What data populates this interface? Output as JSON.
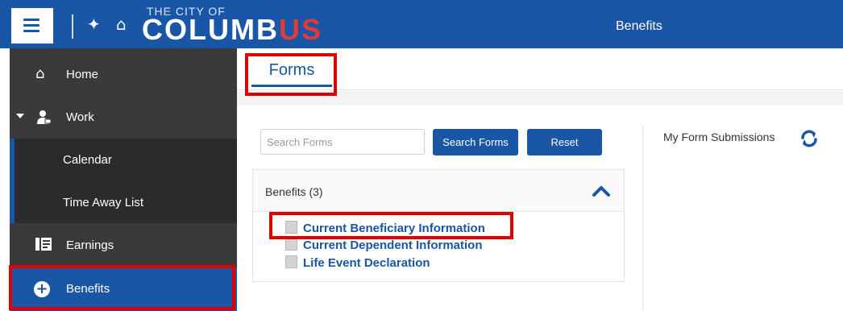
{
  "header": {
    "logo_top": "THE CITY OF",
    "logo_main_left": "COLUMB",
    "logo_main_accent": "US",
    "title": "Benefits"
  },
  "sidebar": {
    "items": [
      {
        "label": "Home",
        "icon": "home-icon"
      },
      {
        "label": "Work",
        "icon": "user-work-icon"
      },
      {
        "label": "Calendar"
      },
      {
        "label": "Time Away List"
      },
      {
        "label": "Earnings",
        "icon": "earnings-icon"
      },
      {
        "label": "Benefits",
        "icon": "plus-circle-icon",
        "active": true
      }
    ]
  },
  "tabs": [
    {
      "label": "Forms",
      "active": true
    }
  ],
  "search": {
    "placeholder": "Search Forms",
    "value": "",
    "search_label": "Search Forms",
    "reset_label": "Reset"
  },
  "forms_panel": {
    "title": "Benefits (3)",
    "items": [
      "Current Beneficiary Information",
      "Current Dependent Information",
      "Life Event Declaration"
    ]
  },
  "submissions": {
    "title": "My Form Submissions"
  },
  "colors": {
    "brand_blue": "#1a56a6",
    "sidebar_bg": "#3a3a3a",
    "highlight_red": "#e00000",
    "logo_accent": "#e03a3a"
  }
}
